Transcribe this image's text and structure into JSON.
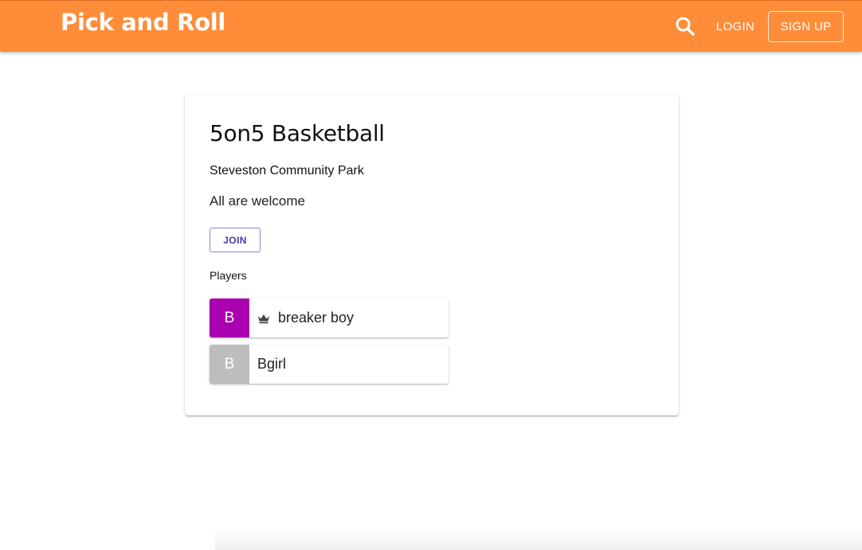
{
  "header": {
    "brand": "Pick and Roll",
    "login_label": "LOGIN",
    "signup_label": "SIGN UP",
    "search_icon": "search-icon",
    "background_color": "#ff8c38"
  },
  "event": {
    "title": "5on5 Basketball",
    "location": "Steveston Community Park",
    "description": "All are welcome",
    "join_label": "JOIN",
    "players_label": "Players",
    "players": [
      {
        "initial": "B",
        "name": "breaker boy",
        "avatar_color": "#a900b0",
        "icon": "crown-icon"
      },
      {
        "initial": "B",
        "name": "Bgirl",
        "avatar_color": "#bdbdbd"
      }
    ]
  }
}
